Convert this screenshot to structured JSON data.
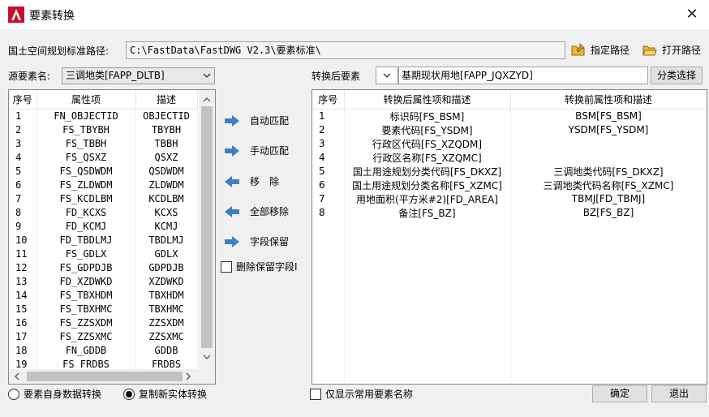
{
  "window": {
    "title": "要素转换",
    "close_symbol": "✕"
  },
  "path_row": {
    "label": "国土空间规划标准路径:",
    "value": "C:\\FastData\\FastDWG V2.3\\要素标准\\",
    "specify_label": "指定路径",
    "open_label": "打开路径"
  },
  "source": {
    "label": "源要素名:",
    "selected": "三调地类[FAPP_DLTB]",
    "columns": [
      "序号",
      "属性项",
      "描述"
    ],
    "rows": [
      [
        "1",
        "FN_OBJECTID",
        "OBJECTID"
      ],
      [
        "2",
        "FS_TBYBH",
        "TBYBH"
      ],
      [
        "3",
        "FS_TBBH",
        "TBBH"
      ],
      [
        "4",
        "FS_QSXZ",
        "QSXZ"
      ],
      [
        "5",
        "FS_QSDWDM",
        "QSDWDM"
      ],
      [
        "6",
        "FS_ZLDWDM",
        "ZLDWDM"
      ],
      [
        "7",
        "FS_KCDLBM",
        "KCDLBM"
      ],
      [
        "8",
        "FD_KCXS",
        "KCXS"
      ],
      [
        "9",
        "FD_KCMJ",
        "KCMJ"
      ],
      [
        "10",
        "FD_TBDLMJ",
        "TBDLMJ"
      ],
      [
        "11",
        "FS_GDLX",
        "GDLX"
      ],
      [
        "12",
        "FS_GDPDJB",
        "GDPDJB"
      ],
      [
        "13",
        "FD_XZDWKD",
        "XZDWKD"
      ],
      [
        "14",
        "FS_TBXHDM",
        "TBXHDM"
      ],
      [
        "15",
        "FS_TBXHMC",
        "TBXHMC"
      ],
      [
        "16",
        "FS_ZZSXDM",
        "ZZSXDM"
      ],
      [
        "17",
        "FS_ZZSXMC",
        "ZZSXMC"
      ],
      [
        "18",
        "FN_GDDB",
        "GDDB"
      ],
      [
        "19",
        "FS_FRDBS",
        "FRDBS"
      ]
    ]
  },
  "actions": {
    "auto_match": "自动匹配",
    "manual_match": "手动匹配",
    "remove": "移　除",
    "remove_all": "全部移除",
    "keep_field": "字段保留",
    "delete_kept": "删除保留字段I"
  },
  "target": {
    "label": "转换后要素",
    "selected": "基期现状用地[FAPP_JQXZYD]",
    "classify_button": "分类选择",
    "columns": [
      "序号",
      "转换后属性项和描述",
      "转换前属性项和描述"
    ],
    "rows": [
      [
        "1",
        "标识码[FS_BSM]",
        "BSM[FS_BSM]"
      ],
      [
        "2",
        "要素代码[FS_YSDM]",
        "YSDM[FS_YSDM]"
      ],
      [
        "3",
        "行政区代码[FS_XZQDM]",
        ""
      ],
      [
        "4",
        "行政区名称[FS_XZQMC]",
        ""
      ],
      [
        "5",
        "国土用途规划分类代码[FS_DKXZ]",
        "三调地类代码[FS_DKXZ]"
      ],
      [
        "6",
        "国土用途规划分类名称[FS_XZMC]",
        "三调地类代码名称[FS_XZMC]"
      ],
      [
        "7",
        "用地面积(平方米#2)[FD_AREA]",
        "TBMJ[FD_TBMJ]"
      ],
      [
        "8",
        "备注[FS_BZ]",
        "BZ[FS_BZ]"
      ]
    ]
  },
  "bottom": {
    "radio_self": "要素自身数据转换",
    "radio_copy": "复制新实体转换",
    "only_common": "仅显示常用要素名称",
    "ok": "确定",
    "exit": "退出"
  },
  "colors": {
    "accent_arrow": "#3d7fc4",
    "app_logo": "#c8102e"
  },
  "icons": [
    "autocad-logo",
    "close-icon",
    "folder-pin-icon",
    "folder-open-icon",
    "arrow-right-icon",
    "arrow-left-icon",
    "chevron-down-icon",
    "scroll-arrow-icon"
  ]
}
